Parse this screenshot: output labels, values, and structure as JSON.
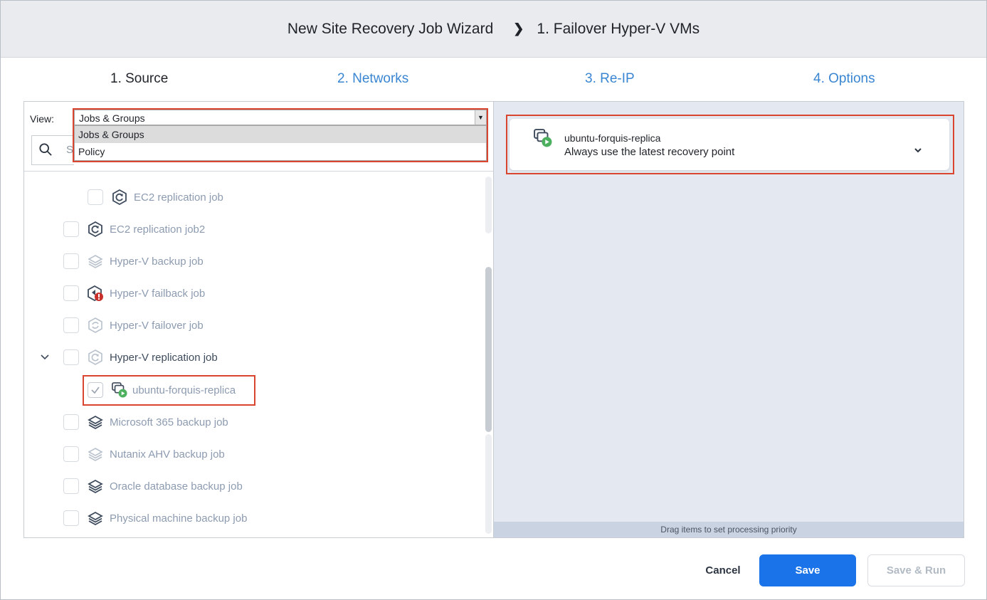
{
  "header": {
    "wizard_title": "New Site Recovery Job Wizard",
    "separator": "❯",
    "current_step_title": "1. Failover Hyper-V VMs"
  },
  "steps": [
    {
      "label": "1. Source",
      "state": "active"
    },
    {
      "label": "2. Networks",
      "state": "link"
    },
    {
      "label": "3. Re-IP",
      "state": "link"
    },
    {
      "label": "4. Options",
      "state": "link"
    }
  ],
  "view_selector": {
    "label": "View:",
    "selected": "Jobs & Groups",
    "options": [
      "Jobs & Groups",
      "Policy"
    ]
  },
  "search": {
    "placeholder": "S"
  },
  "tree": [
    {
      "label": "EC2 replication job",
      "icon": "replication-job-icon",
      "checked": false,
      "dim": true
    },
    {
      "label": "EC2 replication job2",
      "icon": "replication-job-icon",
      "checked": false,
      "dim": true
    },
    {
      "label": "Hyper-V backup job",
      "icon": "backup-job-icon",
      "checked": false,
      "dim": true
    },
    {
      "label": "Hyper-V failback job",
      "icon": "failback-job-error-icon",
      "checked": false,
      "dim": true
    },
    {
      "label": "Hyper-V failover job",
      "icon": "failover-job-icon",
      "checked": false,
      "dim": true
    },
    {
      "label": "Hyper-V replication job",
      "icon": "replication-job-icon",
      "checked": false,
      "dim": false,
      "expanded": true
    },
    {
      "label": "ubuntu-forquis-replica",
      "icon": "vm-replica-running-icon",
      "checked": true,
      "dim": true
    },
    {
      "label": "Microsoft 365 backup job",
      "icon": "backup-job-icon",
      "checked": false,
      "dim": true
    },
    {
      "label": "Nutanix AHV backup job",
      "icon": "backup-job-icon",
      "checked": false,
      "dim": true
    },
    {
      "label": "Oracle database backup job",
      "icon": "backup-job-icon",
      "checked": false,
      "dim": true
    },
    {
      "label": "Physical machine backup job",
      "icon": "backup-job-icon",
      "checked": false,
      "dim": true
    }
  ],
  "selected_items": [
    {
      "name": "ubuntu-forquis-replica",
      "recovery_point": "Always use the latest recovery point"
    }
  ],
  "drag_hint": "Drag items to set processing priority",
  "buttons": {
    "cancel": "Cancel",
    "save": "Save",
    "save_run": "Save & Run"
  },
  "colors": {
    "accent": "#1a73e8",
    "link": "#3a86d2",
    "highlight_box": "#d9452f",
    "running_badge": "#4cb05e",
    "error_badge": "#c9302c"
  }
}
